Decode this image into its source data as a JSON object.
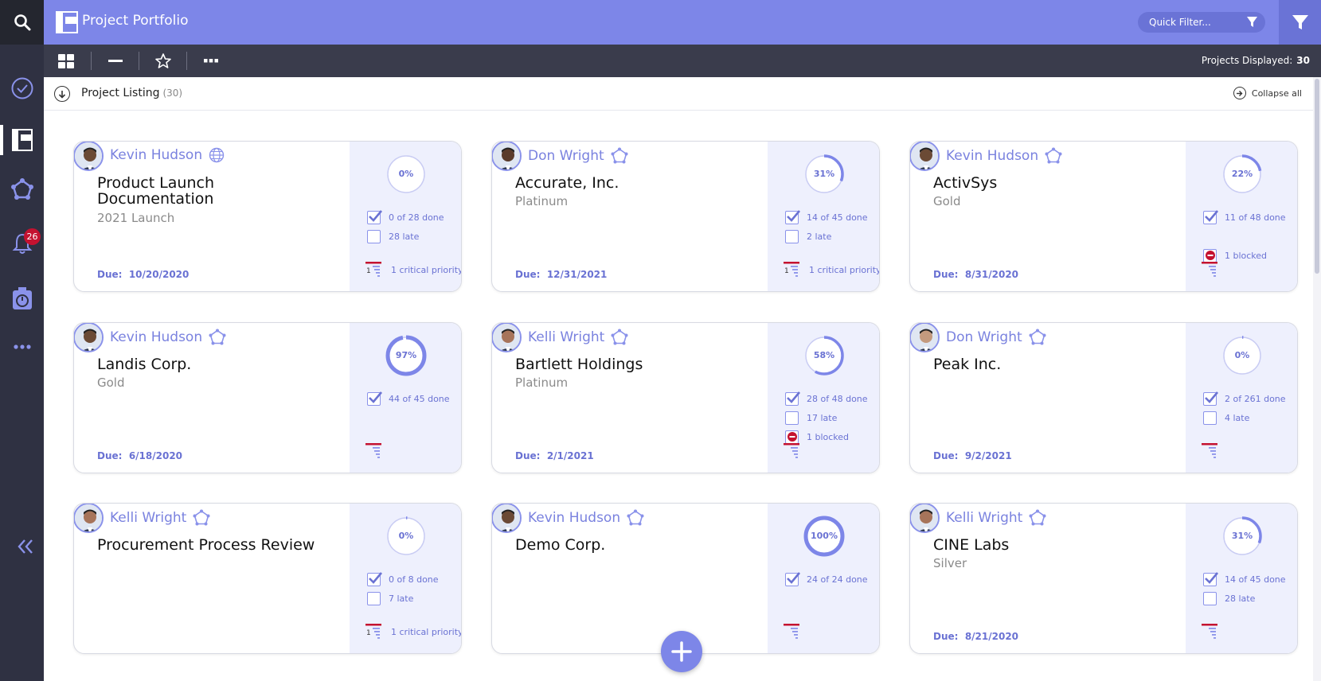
{
  "app": {
    "title": "Project Portfolio"
  },
  "sidebar": {
    "items": [
      {
        "name": "search-icon"
      },
      {
        "name": "check-circle-icon"
      },
      {
        "name": "portfolio-icon",
        "active": true
      },
      {
        "name": "network-icon"
      },
      {
        "name": "bell-icon",
        "badge": "26"
      },
      {
        "name": "timer-icon"
      },
      {
        "name": "more-icon"
      },
      {
        "name": "collapse-sidebar-icon"
      }
    ]
  },
  "header": {
    "quick_filter_placeholder": "Quick Filter...",
    "filter_icon": "funnel-icon"
  },
  "toolbar": {
    "buttons": [
      "grid-view-icon",
      "minus-icon",
      "star-icon",
      "more-icon"
    ],
    "projects_displayed_label": "Projects Displayed:",
    "projects_displayed_count": "30"
  },
  "listing": {
    "title": "Project Listing",
    "count": "(30)",
    "collapse_label": "Collapse all"
  },
  "colors": {
    "accent": "#7d86e8",
    "sidebar": "#2f3142",
    "toolbar": "#3a3c4c",
    "card_right": "#eef0fd",
    "critical": "#c41230"
  },
  "cards": [
    {
      "owner": "Kevin Hudson",
      "owner_icon": "globe-icon",
      "title_line1": "Product Launch",
      "title_line2": "Documentation",
      "subtitle": "2021 Launch",
      "due_label": "Due:",
      "due": "10/20/2020",
      "percent": "0%",
      "progress": 0,
      "done": "0 of 28 done",
      "late": "28 late",
      "blocked": "",
      "critical": "1 critical priority",
      "critical_count": "1"
    },
    {
      "owner": "Don Wright",
      "owner_icon": "network-icon",
      "title_line1": "Accurate, Inc.",
      "title_line2": "",
      "subtitle": "Platinum",
      "due_label": "Due:",
      "due": "12/31/2021",
      "percent": "31%",
      "progress": 0.31,
      "done": "14 of 45 done",
      "late": "2 late",
      "blocked": "",
      "critical": "1 critical priority",
      "critical_count": "1"
    },
    {
      "owner": "Kevin Hudson",
      "owner_icon": "network-icon",
      "title_line1": "ActivSys",
      "title_line2": "",
      "subtitle": "Gold",
      "due_label": "Due:",
      "due": "8/31/2020",
      "percent": "22%",
      "progress": 0.22,
      "done": "11 of 48 done",
      "late": "",
      "blocked": "1 blocked",
      "critical": "",
      "critical_count": ""
    },
    {
      "owner": "Kevin Hudson",
      "owner_icon": "network-icon",
      "title_line1": "Landis Corp.",
      "title_line2": "",
      "subtitle": "Gold",
      "due_label": "Due:",
      "due": "6/18/2020",
      "percent": "97%",
      "progress": 0.97,
      "done": "44 of 45 done",
      "late": "",
      "blocked": "",
      "critical": "",
      "critical_count": ""
    },
    {
      "owner": "Kelli Wright",
      "owner_icon": "network-icon",
      "title_line1": "Bartlett Holdings",
      "title_line2": "",
      "subtitle": "Platinum",
      "due_label": "Due:",
      "due": "2/1/2021",
      "percent": "58%",
      "progress": 0.58,
      "done": "28 of 48 done",
      "late": "17 late",
      "blocked": "1 blocked",
      "critical": "",
      "critical_count": ""
    },
    {
      "owner": "Don Wright",
      "owner_icon": "network-icon",
      "title_line1": "Peak Inc.",
      "title_line2": "",
      "subtitle": "",
      "due_label": "Due:",
      "due": "9/2/2021",
      "percent": "0%",
      "progress": 0.01,
      "done": "2 of 261 done",
      "late": "4 late",
      "blocked": "",
      "critical": "",
      "critical_count": ""
    },
    {
      "owner": "Kelli Wright",
      "owner_icon": "network-icon",
      "title_line1": "Procurement Process Review",
      "title_line2": "",
      "subtitle": "",
      "due_label": "",
      "due": "",
      "percent": "0%",
      "progress": 0.01,
      "done": "0 of 8 done",
      "late": "7 late",
      "blocked": "",
      "critical": "1 critical priority",
      "critical_count": "1"
    },
    {
      "owner": "Kevin Hudson",
      "owner_icon": "network-icon",
      "title_line1": "Demo Corp.",
      "title_line2": "",
      "subtitle": "",
      "due_label": "",
      "due": "",
      "percent": "100%",
      "progress": 1,
      "done": "24 of 24 done",
      "late": "",
      "blocked": "",
      "critical": "",
      "critical_count": ""
    },
    {
      "owner": "Kelli Wright",
      "owner_icon": "network-icon",
      "title_line1": "CINE Labs",
      "title_line2": "",
      "subtitle": "Silver",
      "due_label": "Due:",
      "due": "8/21/2020",
      "percent": "31%",
      "progress": 0.31,
      "done": "14 of 45 done",
      "late": "28 late",
      "blocked": "",
      "critical": "",
      "critical_count": ""
    }
  ],
  "fab": {
    "icon": "plus-icon"
  }
}
